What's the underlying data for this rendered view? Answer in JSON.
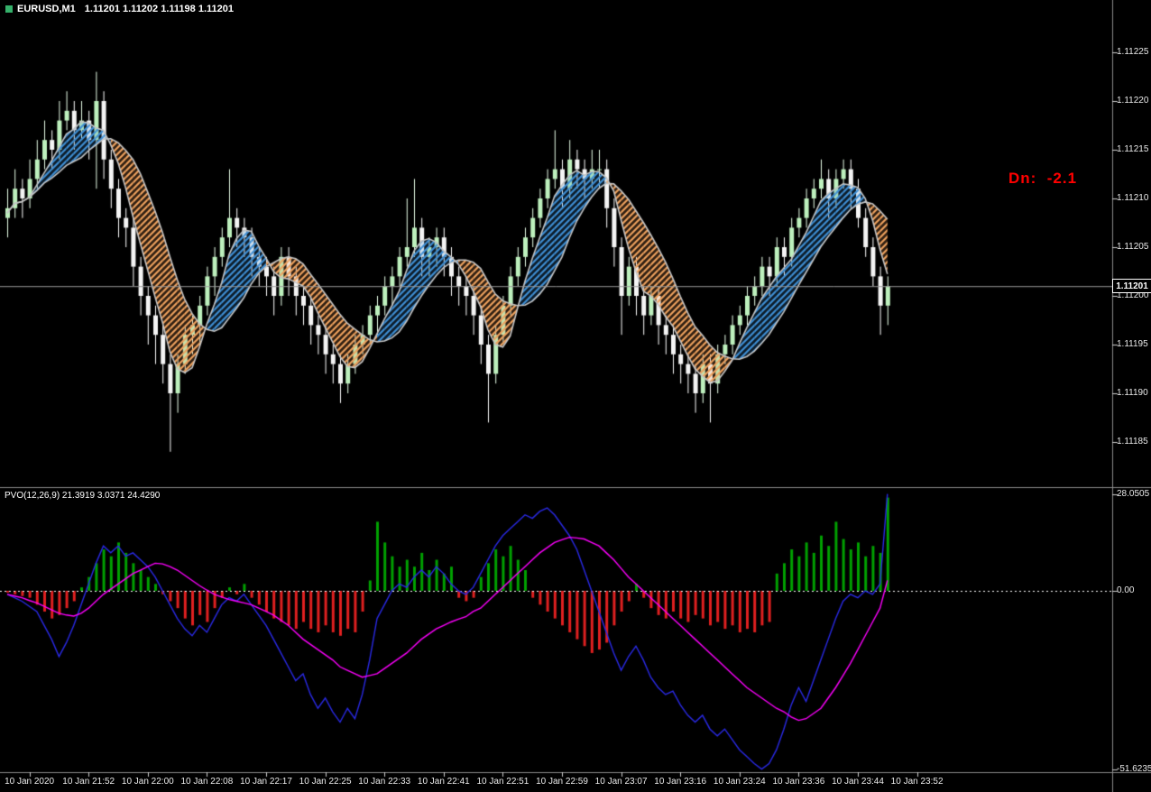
{
  "header": {
    "symbol": "EURUSD,M1",
    "ohlc": "1.11201 1.11202 1.11198 1.11201",
    "icon_color": "#35b06a"
  },
  "annotations": {
    "dn_text": "Dn:  -2.1",
    "dn_color": "#ff0000"
  },
  "indicator": {
    "label": "PVO(12,26,9) 21.3919 3.0371 24.4290"
  },
  "price_axis": {
    "ticks": [
      "1.11225",
      "1.11220",
      "1.11215",
      "1.11210",
      "1.11205",
      "1.11200",
      "1.11195",
      "1.11190",
      "1.11185"
    ],
    "current_label": "1.11201",
    "current_value": 1.11201
  },
  "time_axis": {
    "labels": [
      {
        "text": "10 Jan 2020",
        "index": 3
      },
      {
        "text": "10 Jan 21:52",
        "index": 11
      },
      {
        "text": "10 Jan 22:00",
        "index": 19
      },
      {
        "text": "10 Jan 22:08",
        "index": 27
      },
      {
        "text": "10 Jan 22:17",
        "index": 35
      },
      {
        "text": "10 Jan 22:25",
        "index": 43
      },
      {
        "text": "10 Jan 22:33",
        "index": 51
      },
      {
        "text": "10 Jan 22:41",
        "index": 59
      },
      {
        "text": "10 Jan 22:51",
        "index": 67
      },
      {
        "text": "10 Jan 22:59",
        "index": 75
      },
      {
        "text": "10 Jan 23:07",
        "index": 83
      },
      {
        "text": "10 Jan 23:16",
        "index": 91
      },
      {
        "text": "10 Jan 23:24",
        "index": 99
      },
      {
        "text": "10 Jan 23:36",
        "index": 107
      },
      {
        "text": "10 Jan 23:44",
        "index": 115
      },
      {
        "text": "10 Jan 23:52",
        "index": 123
      }
    ]
  },
  "chart_data": [
    {
      "type": "candlestick",
      "title": "EURUSD M1",
      "price_base": 1.11,
      "unit": 1e-05,
      "ylim": [
        1.11183,
        1.11228
      ],
      "yticks": [
        1.11225,
        1.1122,
        1.11215,
        1.1121,
        1.11205,
        1.112,
        1.11195,
        1.1119,
        1.11185
      ],
      "current_price": 1.11201,
      "bull_color": "#bdf0bd",
      "bear_color": "#f4f4f4",
      "wick_bull": "#e9ffe9",
      "wick_bear": "#ffffff",
      "ribbon": {
        "up_color": "#3f8fd4",
        "down_color": "#eea15e",
        "edge_color": "#c4c4c4",
        "fast_period": 4,
        "slow_period": 11
      },
      "candles": [
        [
          208,
          211,
          206,
          209
        ],
        [
          209,
          213,
          208,
          211
        ],
        [
          211,
          212,
          208,
          210
        ],
        [
          210,
          214,
          209,
          212
        ],
        [
          212,
          216,
          211,
          214
        ],
        [
          214,
          218,
          213,
          216
        ],
        [
          216,
          217,
          213,
          215
        ],
        [
          215,
          220,
          214,
          218
        ],
        [
          218,
          221,
          217,
          219
        ],
        [
          219,
          220,
          215,
          217
        ],
        [
          217,
          220,
          216,
          218
        ],
        [
          218,
          219,
          214,
          216
        ],
        [
          216,
          223,
          211,
          220
        ],
        [
          220,
          221,
          212,
          214
        ],
        [
          214,
          215,
          209,
          211
        ],
        [
          211,
          212,
          206,
          208
        ],
        [
          208,
          209,
          205,
          207
        ],
        [
          207,
          208,
          201,
          203
        ],
        [
          203,
          204,
          198,
          200
        ],
        [
          200,
          201,
          195,
          198
        ],
        [
          198,
          199,
          193,
          196
        ],
        [
          196,
          197,
          191,
          193
        ],
        [
          193,
          194,
          184,
          190
        ],
        [
          190,
          194,
          188,
          193
        ],
        [
          193,
          197,
          192,
          196
        ],
        [
          196,
          198,
          194,
          197
        ],
        [
          197,
          200,
          195,
          199
        ],
        [
          199,
          203,
          198,
          202
        ],
        [
          202,
          205,
          200,
          204
        ],
        [
          204,
          207,
          203,
          206
        ],
        [
          206,
          213,
          205,
          208
        ],
        [
          208,
          209,
          205,
          207
        ],
        [
          207,
          208,
          204,
          206
        ],
        [
          206,
          207,
          202,
          204
        ],
        [
          204,
          205,
          201,
          203
        ],
        [
          203,
          204,
          200,
          202
        ],
        [
          202,
          203,
          198,
          200
        ],
        [
          200,
          205,
          199,
          204
        ],
        [
          204,
          205,
          200,
          202
        ],
        [
          202,
          203,
          198,
          200
        ],
        [
          200,
          201,
          197,
          199
        ],
        [
          199,
          200,
          195,
          197
        ],
        [
          197,
          198,
          194,
          196
        ],
        [
          196,
          197,
          192,
          194
        ],
        [
          194,
          195,
          191,
          193
        ],
        [
          193,
          194,
          189,
          191
        ],
        [
          191,
          194,
          190,
          193
        ],
        [
          193,
          196,
          192,
          195
        ],
        [
          195,
          197,
          194,
          196
        ],
        [
          196,
          199,
          195,
          198
        ],
        [
          198,
          200,
          196,
          199
        ],
        [
          199,
          202,
          198,
          201
        ],
        [
          201,
          203,
          199,
          202
        ],
        [
          202,
          205,
          201,
          204
        ],
        [
          204,
          210,
          203,
          205
        ],
        [
          205,
          212,
          204,
          207
        ],
        [
          207,
          208,
          202,
          204
        ],
        [
          204,
          206,
          202,
          205
        ],
        [
          205,
          207,
          203,
          206
        ],
        [
          206,
          207,
          202,
          204
        ],
        [
          204,
          205,
          200,
          202
        ],
        [
          202,
          203,
          199,
          201
        ],
        [
          201,
          202,
          198,
          200
        ],
        [
          200,
          201,
          196,
          198
        ],
        [
          198,
          199,
          193,
          195
        ],
        [
          195,
          196,
          187,
          192
        ],
        [
          192,
          197,
          191,
          196
        ],
        [
          196,
          200,
          195,
          199
        ],
        [
          199,
          203,
          198,
          202
        ],
        [
          202,
          205,
          201,
          204
        ],
        [
          204,
          207,
          203,
          206
        ],
        [
          206,
          209,
          205,
          208
        ],
        [
          208,
          211,
          207,
          210
        ],
        [
          210,
          213,
          209,
          212
        ],
        [
          212,
          217,
          211,
          213
        ],
        [
          213,
          214,
          209,
          211
        ],
        [
          211,
          216,
          210,
          214
        ],
        [
          214,
          215,
          211,
          213
        ],
        [
          213,
          214,
          210,
          212
        ],
        [
          212,
          215,
          211,
          213
        ],
        [
          213,
          215,
          211,
          213
        ],
        [
          213,
          214,
          207,
          209
        ],
        [
          209,
          210,
          203,
          205
        ],
        [
          205,
          206,
          196,
          200
        ],
        [
          200,
          204,
          199,
          203
        ],
        [
          203,
          204,
          198,
          200
        ],
        [
          200,
          201,
          196,
          198
        ],
        [
          198,
          201,
          197,
          200
        ],
        [
          200,
          201,
          195,
          197
        ],
        [
          197,
          198,
          194,
          196
        ],
        [
          196,
          197,
          192,
          194
        ],
        [
          194,
          195,
          191,
          193
        ],
        [
          193,
          194,
          190,
          192
        ],
        [
          192,
          193,
          188,
          190
        ],
        [
          190,
          194,
          189,
          193
        ],
        [
          193,
          194,
          187,
          191
        ],
        [
          191,
          195,
          190,
          194
        ],
        [
          194,
          196,
          193,
          195
        ],
        [
          195,
          198,
          194,
          197
        ],
        [
          197,
          199,
          196,
          198
        ],
        [
          198,
          201,
          197,
          200
        ],
        [
          200,
          202,
          199,
          201
        ],
        [
          201,
          204,
          200,
          203
        ],
        [
          203,
          204,
          200,
          202
        ],
        [
          202,
          206,
          201,
          205
        ],
        [
          205,
          206,
          202,
          204
        ],
        [
          204,
          208,
          203,
          207
        ],
        [
          207,
          209,
          206,
          208
        ],
        [
          208,
          211,
          207,
          210
        ],
        [
          210,
          212,
          209,
          211
        ],
        [
          211,
          214,
          210,
          212
        ],
        [
          212,
          213,
          208,
          210
        ],
        [
          210,
          213,
          209,
          212
        ],
        [
          212,
          214,
          211,
          213
        ],
        [
          213,
          214,
          209,
          211
        ],
        [
          211,
          212,
          207,
          208
        ],
        [
          208,
          209,
          204,
          205
        ],
        [
          205,
          206,
          201,
          202
        ],
        [
          202,
          203,
          196,
          199
        ],
        [
          199,
          202,
          197,
          201
        ]
      ]
    },
    {
      "type": "bar",
      "name": "PVO(12,26,9)",
      "ylim": [
        -51.6235,
        28.0505
      ],
      "yticks": [
        {
          "value": 28.0505,
          "label": "28.0505"
        },
        {
          "value": 0,
          "label": "0.00"
        },
        {
          "value": -51.6235,
          "label": "-51.6235"
        }
      ],
      "histogram": {
        "up_color": "#00a000",
        "down_color": "#e02020",
        "values": [
          -0.5,
          -1,
          -1.5,
          -2,
          -4,
          -6,
          -8,
          -7,
          -5,
          -3,
          1,
          4,
          8,
          12,
          10,
          14,
          11,
          8,
          6,
          4,
          2,
          -1,
          -3,
          -5,
          -8,
          -10,
          -7,
          -9,
          -5,
          -2,
          1,
          -1,
          2,
          -2,
          -4,
          -6,
          -8,
          -9,
          -10,
          -11,
          -9,
          -11,
          -12,
          -10,
          -12,
          -13,
          -11,
          -12,
          -6,
          3,
          20,
          14,
          10,
          7,
          9,
          7,
          11,
          6,
          9,
          5,
          7,
          -2,
          -3,
          -2,
          4,
          8,
          12,
          10,
          13,
          9,
          6,
          -2,
          -4,
          -6,
          -8,
          -10,
          -12,
          -14,
          -16,
          -18,
          -17,
          -15,
          -10,
          -6,
          -3,
          2,
          -2,
          -5,
          -7,
          -8,
          -6,
          -8,
          -9,
          -7,
          -8,
          -10,
          -9,
          -11,
          -10,
          -12,
          -11,
          -12,
          -10,
          -9,
          5,
          8,
          12,
          10,
          14,
          11,
          16,
          13,
          20,
          15,
          12,
          14,
          10,
          13,
          11,
          27
        ]
      },
      "series": [
        {
          "name": "pvo_line",
          "color": "#2a2ae8",
          "values": [
            -1,
            -2,
            -3,
            -4.5,
            -6,
            -10,
            -14,
            -19,
            -15,
            -10,
            -4,
            2,
            8,
            13,
            11,
            13,
            10,
            11,
            9,
            7,
            4,
            0,
            -4,
            -8,
            -11,
            -13,
            -10,
            -12,
            -8,
            -4,
            -2,
            -3,
            -1,
            -4,
            -7,
            -10,
            -14,
            -18,
            -22,
            -26,
            -24,
            -30,
            -34,
            -31,
            -35,
            -38,
            -34,
            -37,
            -30,
            -20,
            -8,
            -4,
            0,
            2,
            1,
            4,
            6,
            4,
            7,
            5,
            2,
            0,
            -1,
            1,
            5,
            9,
            13,
            16,
            18,
            20,
            22,
            21,
            23,
            24,
            22,
            19,
            16,
            12,
            6,
            0,
            -6,
            -12,
            -18,
            -23,
            -19,
            -16,
            -20,
            -25,
            -28,
            -30,
            -29,
            -33,
            -36,
            -38,
            -36,
            -40,
            -42,
            -40,
            -43,
            -46,
            -48,
            -50,
            -51.6,
            -50,
            -46,
            -40,
            -33,
            -28,
            -32,
            -26,
            -20,
            -14,
            -8,
            -3,
            -1,
            -2,
            0,
            -1,
            2,
            28.05
          ]
        },
        {
          "name": "signal_line",
          "color": "#ff00ff",
          "values": [
            -1,
            -1.5,
            -2,
            -2.8,
            -3.5,
            -4.5,
            -5.5,
            -6.5,
            -7,
            -7.3,
            -6.5,
            -5,
            -3,
            -1,
            0.5,
            2,
            3.5,
            5,
            6,
            7,
            8,
            7.8,
            7,
            6,
            4.5,
            3,
            1.5,
            0.2,
            -1,
            -1.8,
            -2.5,
            -3,
            -3.5,
            -4,
            -5,
            -6,
            -7,
            -8.5,
            -10,
            -12,
            -14,
            -15.5,
            -17,
            -18.5,
            -20,
            -22,
            -23,
            -24,
            -25,
            -24.5,
            -24,
            -22.5,
            -21,
            -19.5,
            -18,
            -16,
            -14,
            -12.5,
            -11,
            -10,
            -9,
            -8.2,
            -7.5,
            -6,
            -5,
            -3,
            -1,
            1,
            3,
            5,
            7,
            9,
            11,
            12.5,
            14,
            14.8,
            15.5,
            15.3,
            15,
            14,
            13,
            11,
            9,
            6.5,
            4,
            2,
            0,
            -2,
            -4,
            -6,
            -8,
            -10,
            -12,
            -14,
            -16,
            -18,
            -20,
            -22,
            -24,
            -26,
            -28,
            -29.5,
            -31,
            -32.5,
            -34,
            -35,
            -36.5,
            -37.5,
            -37,
            -35.5,
            -34,
            -31,
            -28,
            -24.5,
            -21,
            -17,
            -13,
            -9,
            -5,
            3.04
          ]
        }
      ]
    }
  ]
}
